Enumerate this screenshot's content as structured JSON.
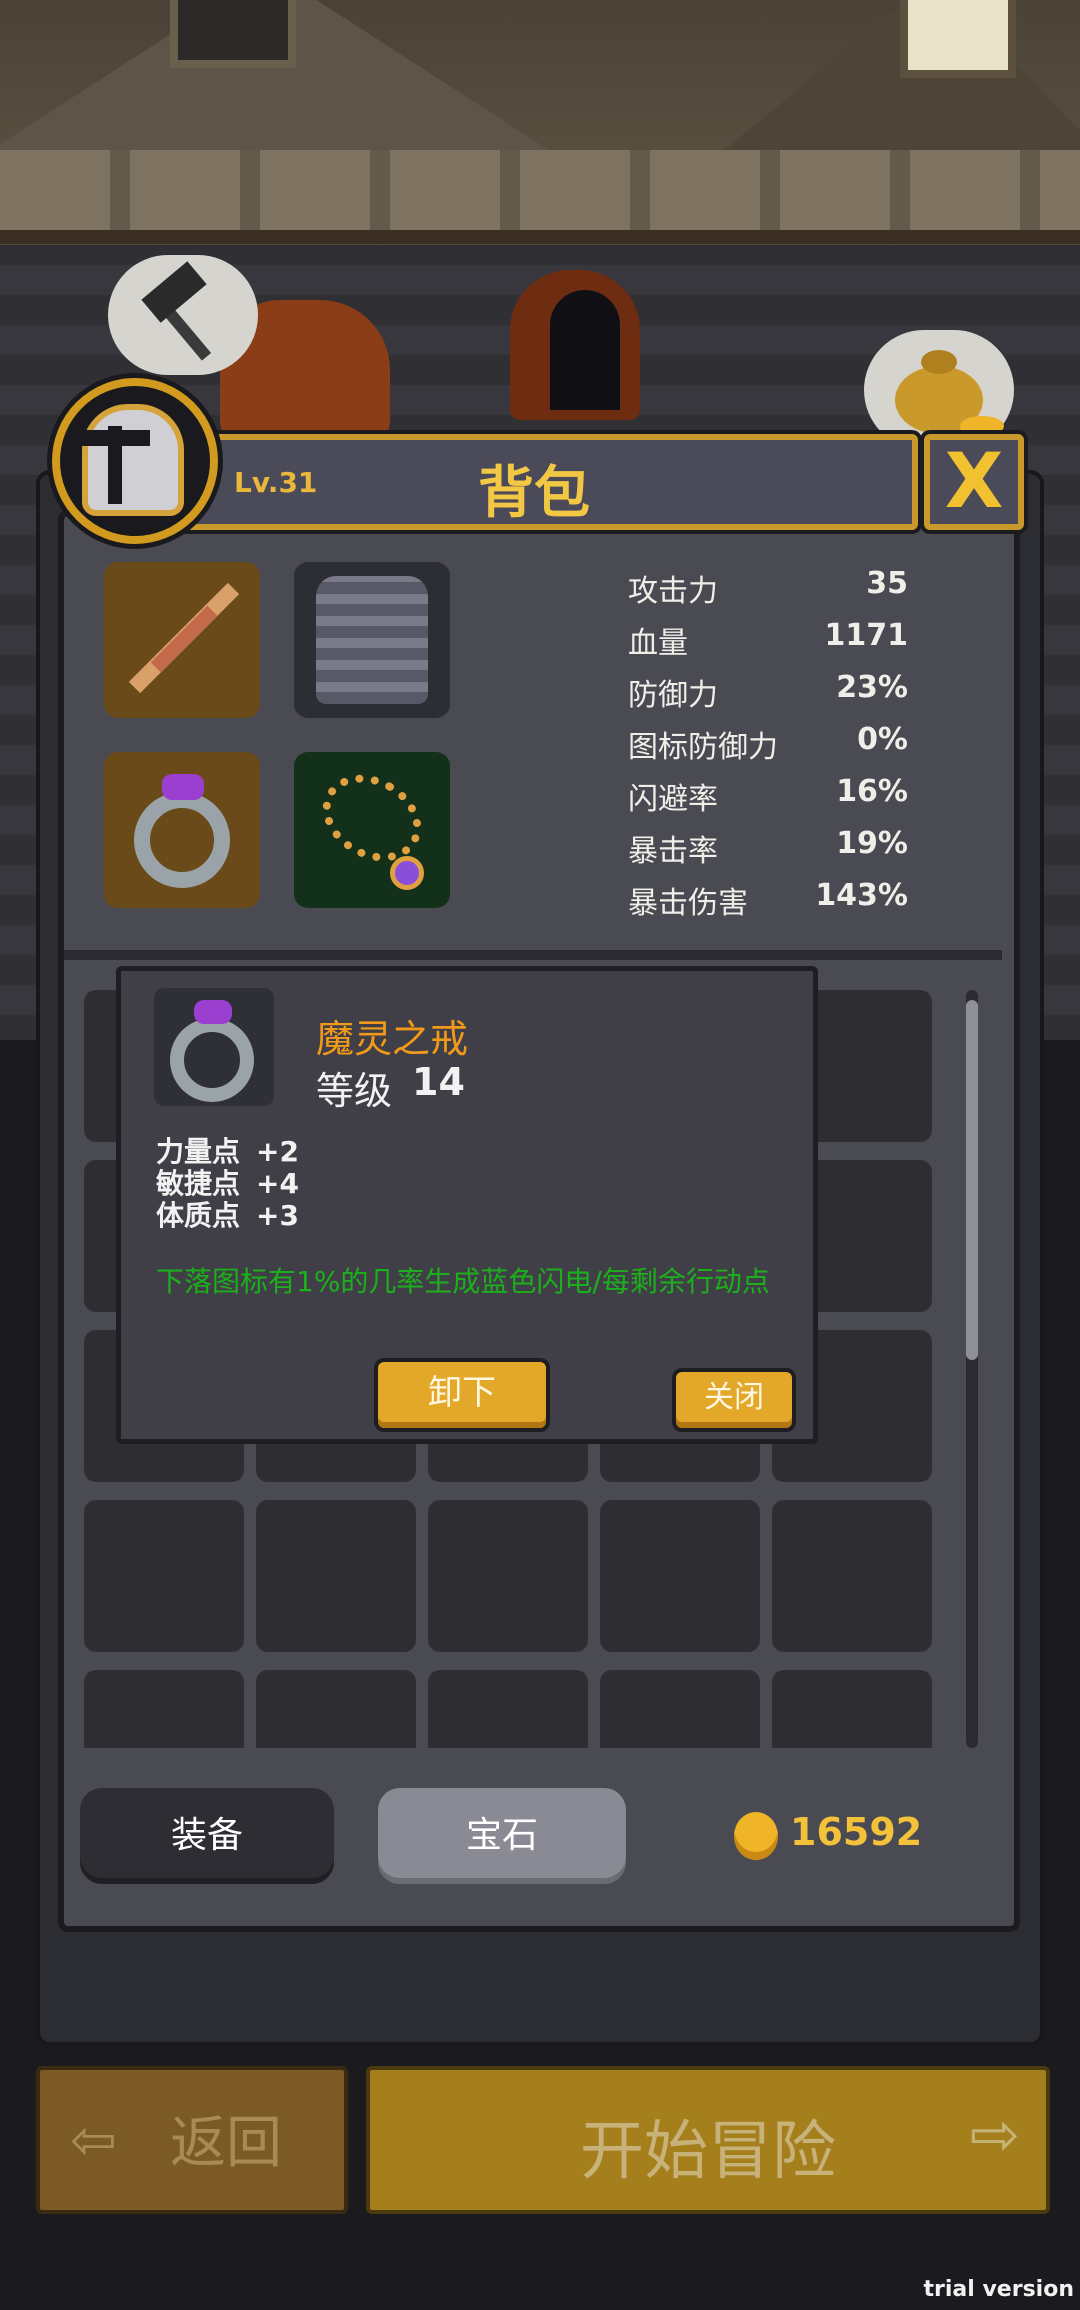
{
  "header": {
    "title": "背包",
    "level": "Lv.31",
    "close_icon_label": "X"
  },
  "stats": [
    {
      "label": "攻击力",
      "value": "35"
    },
    {
      "label": "血量",
      "value": "1171"
    },
    {
      "label": "防御力",
      "value": "23%"
    },
    {
      "label": "图标防御力",
      "value": "0%"
    },
    {
      "label": "闪避率",
      "value": "16%"
    },
    {
      "label": "暴击率",
      "value": "19%"
    },
    {
      "label": "暴击伤害",
      "value": "143%"
    }
  ],
  "equipment": [
    "sword-icon",
    "armor-icon",
    "ring-icon",
    "necklace-icon"
  ],
  "popup": {
    "item_name": "魔灵之戒",
    "level_label": "等级",
    "level_value": "14",
    "attributes": [
      {
        "label": "力量点",
        "value": "+2"
      },
      {
        "label": "敏捷点",
        "value": "+4"
      },
      {
        "label": "体质点",
        "value": "+3"
      }
    ],
    "effect": "下落图标有1%的几率生成蓝色闪电/每剩余行动点",
    "unequip_label": "卸下",
    "close_label": "关闭"
  },
  "tabs": {
    "equip_label": "装备",
    "gem_label": "宝石"
  },
  "gold": "16592",
  "actions": {
    "back_label": "返回",
    "start_label": "开始冒险"
  },
  "watermark": "trial version",
  "colors": {
    "accent_gold": "#e3a82a",
    "item_name": "#f19a1a",
    "effect_text": "#1bb01b"
  }
}
